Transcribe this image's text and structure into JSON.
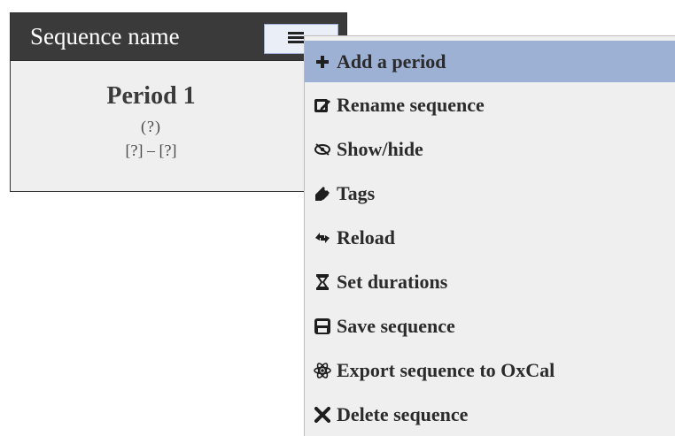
{
  "sequence": {
    "name": "Sequence name",
    "period": {
      "title": "Period 1",
      "uncertainty": "(?)",
      "range": "[?] – [?]"
    }
  },
  "menu": {
    "toggle_icon": "hamburger-icon",
    "items": [
      {
        "label": "Add a period",
        "icon": "plus-icon",
        "active": true
      },
      {
        "label": "Rename sequence",
        "icon": "edit-icon",
        "active": false
      },
      {
        "label": "Show/hide",
        "icon": "eye-slash-icon",
        "active": false
      },
      {
        "label": "Tags",
        "icon": "tag-icon",
        "active": false
      },
      {
        "label": "Reload",
        "icon": "reload-icon",
        "active": false
      },
      {
        "label": "Set durations",
        "icon": "hourglass-icon",
        "active": false
      },
      {
        "label": "Save sequence",
        "icon": "save-icon",
        "active": false
      },
      {
        "label": "Export sequence to OxCal",
        "icon": "atom-icon",
        "active": false
      },
      {
        "label": "Delete sequence",
        "icon": "close-icon",
        "active": false
      }
    ]
  },
  "colors": {
    "header_bg": "#3a3a3a",
    "card_bg": "#efefef",
    "active_item_bg": "#9db1d4",
    "toggle_bg": "#e9eef7"
  }
}
